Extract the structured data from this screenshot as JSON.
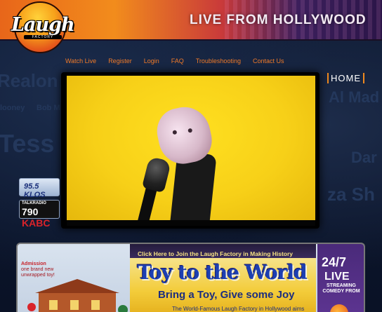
{
  "header": {
    "logo_text": "Laugh",
    "logo_sub": "FACTORY",
    "tagline": "LIVE FROM HOLLYWOOD"
  },
  "nav": {
    "items": [
      "Watch Live",
      "Register",
      "Login",
      "FAQ",
      "Troubleshooting",
      "Contact Us"
    ],
    "home_label": "HOME"
  },
  "background_names": [
    "Realon",
    "Al Mad",
    "Clooney",
    "Bob M",
    "Dar",
    "Tess",
    "za Sh"
  ],
  "radio": {
    "klos": "95.5 KLOS",
    "talkradio": "TALKRADIO",
    "kabc_num": "790",
    "kabc_call": "KABC"
  },
  "banner": {
    "cta": "Click Here to Join the Laugh Factory in Making History",
    "admission_line1": "Admission",
    "admission_line2": "one brand new unwrapped toy!",
    "title": "Toy to the World",
    "subtitle": "Bring a Toy, Give some Joy",
    "small_text": "The World-Famous Laugh Factory in Hollywood aims",
    "side_247": "24/7",
    "side_live": "LIVE",
    "side_small": "STREAMING COMEDY FROM"
  },
  "colors": {
    "nav_text": "#f07a28",
    "accent_orange": "#f08a1e",
    "video_bg": "#f7d018",
    "page_bg": "#0a1428"
  }
}
